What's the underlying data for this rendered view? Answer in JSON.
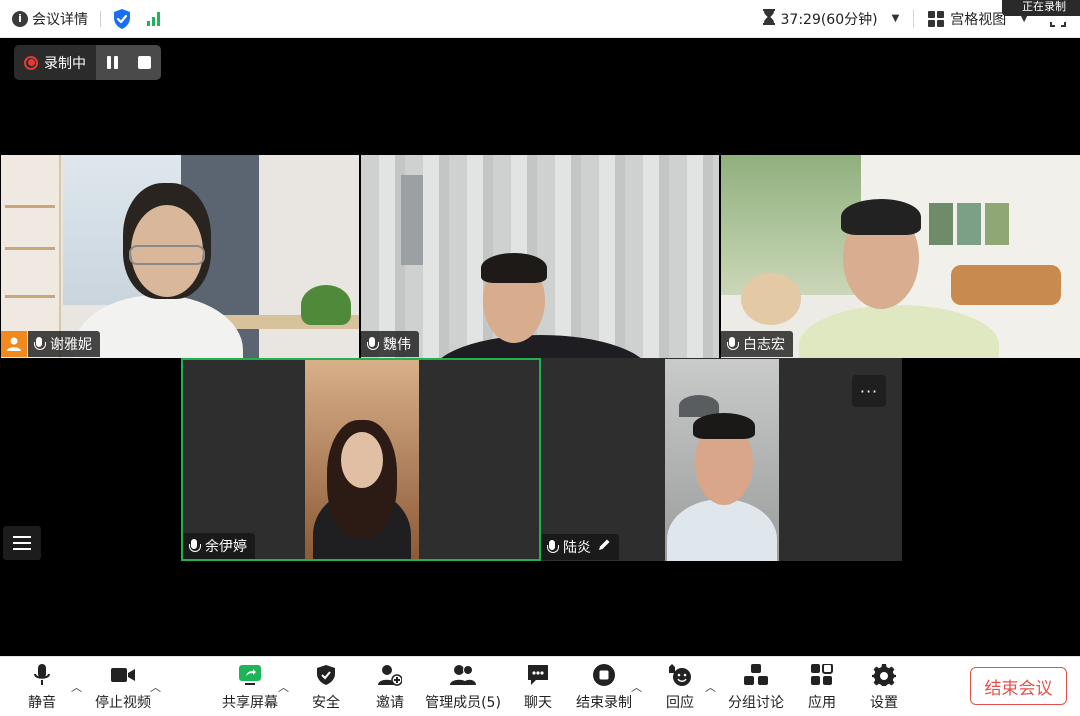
{
  "topbar": {
    "info_icon": "i",
    "meeting_details": "会议详情",
    "timer": "37:29(60分钟)",
    "view_label": "宫格视图",
    "recording_tip": "正在录制"
  },
  "recording": {
    "status": "录制中"
  },
  "participants": [
    {
      "name": "谢雅妮",
      "host": true
    },
    {
      "name": "魏伟"
    },
    {
      "name": "白志宏"
    },
    {
      "name": "余伊婷",
      "active_speaker": true
    },
    {
      "name": "陆炎",
      "editable": true
    }
  ],
  "more_button": "···",
  "toolbar": {
    "mute": "静音",
    "stop_video": "停止视频",
    "share_screen": "共享屏幕",
    "security": "安全",
    "invite": "邀请",
    "manage_members": "管理成员(5)",
    "chat": "聊天",
    "end_recording": "结束录制",
    "reactions": "回应",
    "breakout": "分组讨论",
    "apps": "应用",
    "settings": "设置",
    "end_meeting": "结束会议"
  },
  "colors": {
    "accent_green": "#1fb45a",
    "record_red": "#e53935",
    "end_red": "#e5514a",
    "host_orange": "#f08a1e",
    "shield_blue": "#1a6ff0"
  }
}
